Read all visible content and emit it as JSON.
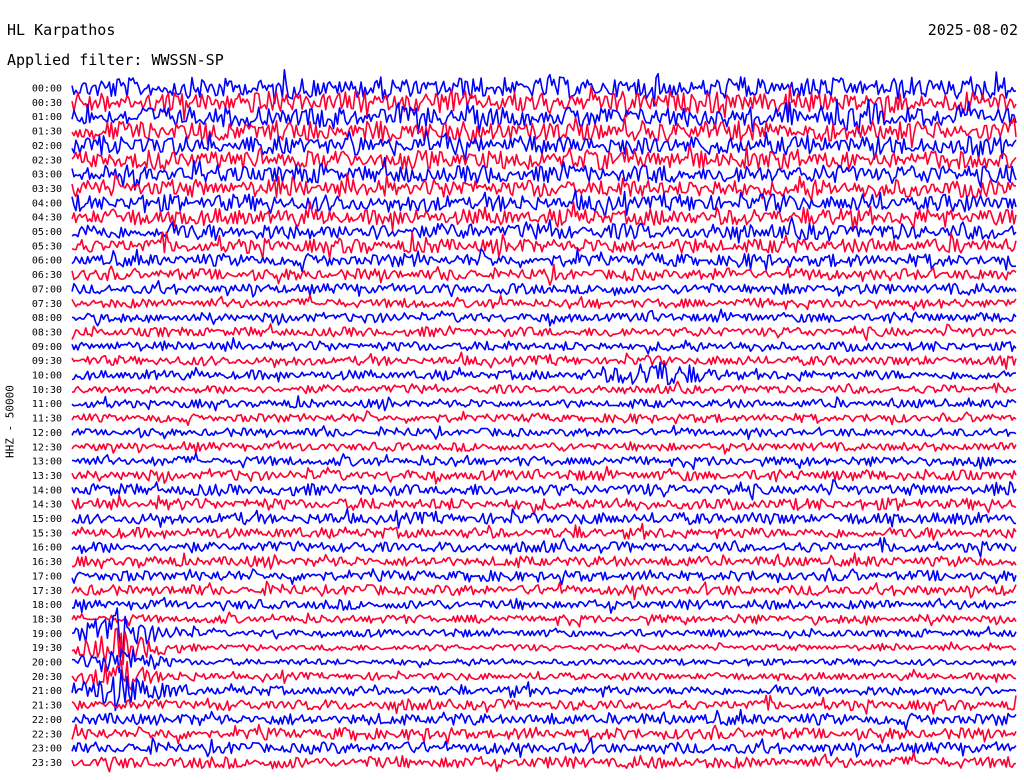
{
  "header": {
    "station": "HL Karpathos",
    "date": "2025-08-02",
    "filter": "Applied filter: WWSSN-SP"
  },
  "chart_data": {
    "type": "line",
    "title": "HL Karpathos",
    "ylabel": "HHZ - 50000",
    "colors": [
      "#0000ff",
      "#ff0033"
    ],
    "time_labels": [
      "00:00",
      "00:30",
      "01:00",
      "01:30",
      "02:00",
      "02:30",
      "03:00",
      "03:30",
      "04:00",
      "04:30",
      "05:00",
      "05:30",
      "06:00",
      "06:30",
      "07:00",
      "07:30",
      "08:00",
      "08:30",
      "09:00",
      "09:30",
      "10:00",
      "10:30",
      "11:00",
      "11:30",
      "12:00",
      "12:30",
      "13:00",
      "13:30",
      "14:00",
      "14:30",
      "15:00",
      "15:30",
      "16:00",
      "16:30",
      "17:00",
      "17:30",
      "18:00",
      "18:30",
      "19:00",
      "19:30",
      "20:00",
      "20:30",
      "21:00",
      "21:30",
      "22:00",
      "22:30",
      "23:00",
      "23:30"
    ],
    "noise_level": [
      1.0,
      1.0,
      0.95,
      0.95,
      0.9,
      0.9,
      0.85,
      0.85,
      0.8,
      0.8,
      0.75,
      0.7,
      0.6,
      0.55,
      0.5,
      0.45,
      0.45,
      0.45,
      0.45,
      0.45,
      0.45,
      0.4,
      0.4,
      0.4,
      0.4,
      0.4,
      0.45,
      0.5,
      0.55,
      0.55,
      0.55,
      0.5,
      0.5,
      0.5,
      0.5,
      0.5,
      0.45,
      0.4,
      0.35,
      0.3,
      0.3,
      0.35,
      0.45,
      0.5,
      0.55,
      0.55,
      0.55,
      0.55
    ],
    "events": [
      {
        "trace": "10:00",
        "minute": 18.5,
        "amplitude": 3.0
      },
      {
        "trace": "19:00",
        "minute": 1.5,
        "amplitude": 6.0
      },
      {
        "trace": "19:30",
        "minute": 1.5,
        "amplitude": 6.0
      },
      {
        "trace": "20:00",
        "minute": 1.5,
        "amplitude": 5.0
      },
      {
        "trace": "20:30",
        "minute": 1.5,
        "amplitude": 4.0
      },
      {
        "trace": "21:00",
        "minute": 1.5,
        "amplitude": 4.0
      }
    ]
  }
}
